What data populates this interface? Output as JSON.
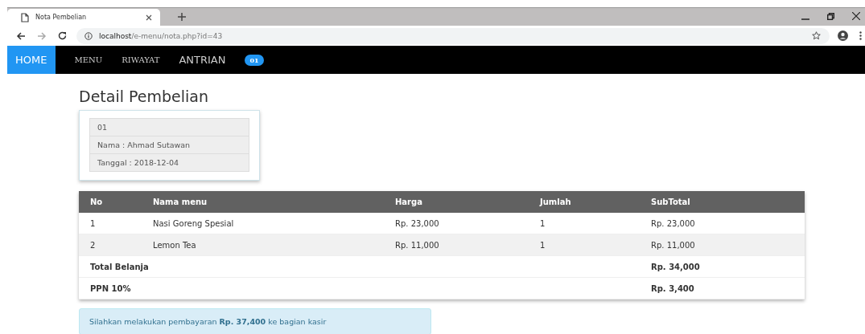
{
  "browser": {
    "tab_title": "Nota Pembelian",
    "url_host": "localhost",
    "url_path": "/e-menu/nota.php?id=43"
  },
  "nav": {
    "items": [
      {
        "label": "HOME",
        "selected": true,
        "kind": "large"
      },
      {
        "label": "MENU",
        "selected": false,
        "kind": "small"
      },
      {
        "label": "RIWAYAT",
        "selected": false,
        "kind": "small"
      },
      {
        "label": "ANTRIAN",
        "selected": false,
        "kind": "large"
      }
    ],
    "badge": "01"
  },
  "title": "Detail Pembelian",
  "info": [
    "01",
    "Nama : Ahmad Sutawan",
    "Tanggal  : 2018-12-04"
  ],
  "table": {
    "columns": [
      "No",
      "Nama menu",
      "Harga",
      "Jumlah",
      "SubTotal"
    ],
    "rows": [
      [
        "1",
        "Nasi Goreng Spesial",
        "Rp. 23,000",
        "1",
        "Rp. 23,000"
      ],
      [
        "2",
        "Lemon Tea",
        "Rp. 11,000",
        "1",
        "Rp. 11,000"
      ]
    ],
    "totals": [
      {
        "label": "Total Belanja",
        "value": "Rp. 34,000"
      },
      {
        "label": "PPN 10%",
        "value": "Rp. 3,400"
      }
    ]
  },
  "alert": "Silahkan melakukan pembayaran **Rp. 37,400** ke bagian kasir"
}
